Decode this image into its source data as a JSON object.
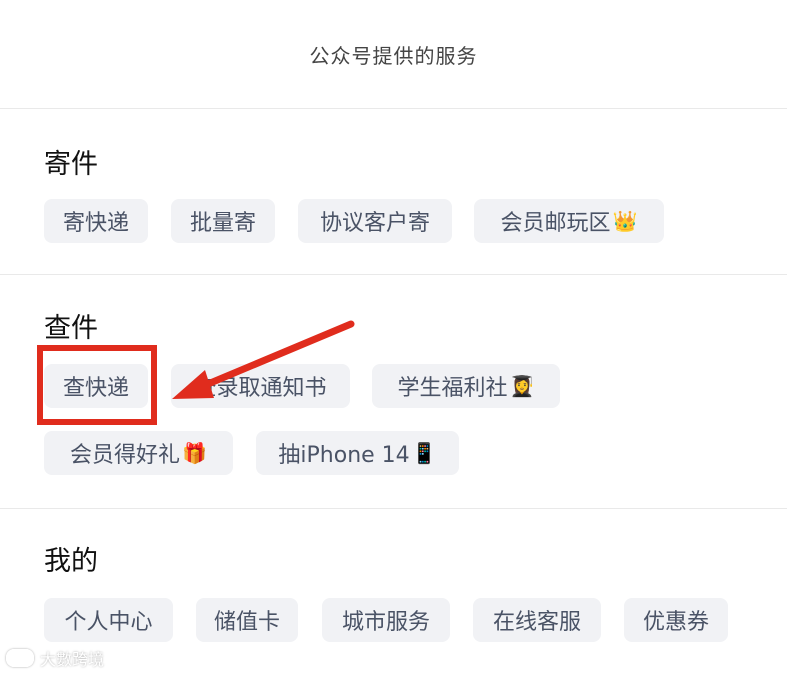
{
  "header": {
    "title": "公众号提供的服务"
  },
  "sections": [
    {
      "title": "寄件",
      "chips": [
        {
          "label": "寄快递",
          "emoji": ""
        },
        {
          "label": "批量寄",
          "emoji": ""
        },
        {
          "label": "协议客户寄",
          "emoji": ""
        },
        {
          "label": "会员邮玩区",
          "emoji": "👑"
        }
      ]
    },
    {
      "title": "查件",
      "chips": [
        {
          "label": "查快递",
          "emoji": ""
        },
        {
          "label": "查录取通知书",
          "emoji": ""
        },
        {
          "label": "学生福利社",
          "emoji": "👩‍🎓"
        },
        {
          "label": "会员得好礼",
          "emoji": "🎁"
        },
        {
          "label": "抽iPhone 14",
          "emoji": "📱"
        }
      ]
    },
    {
      "title": "我的",
      "chips": [
        {
          "label": "个人中心",
          "emoji": ""
        },
        {
          "label": "储值卡",
          "emoji": ""
        },
        {
          "label": "城市服务",
          "emoji": ""
        },
        {
          "label": "在线客服",
          "emoji": ""
        },
        {
          "label": "优惠券",
          "emoji": ""
        }
      ]
    }
  ],
  "watermark": {
    "text": "大數跨境"
  },
  "colors": {
    "accent": "#e02c1d",
    "chip_bg": "#f1f2f5",
    "chip_text": "#4a5366"
  }
}
